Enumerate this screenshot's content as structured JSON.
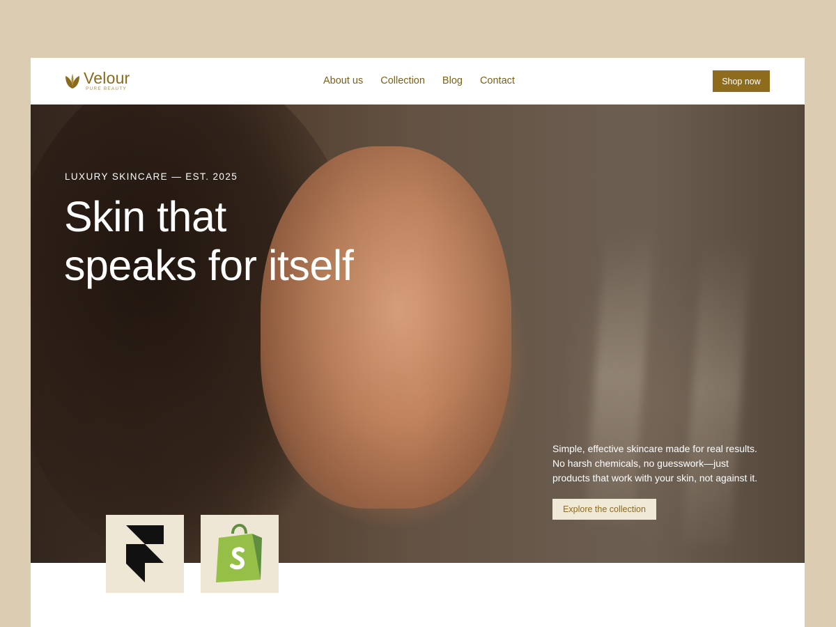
{
  "brand": {
    "name": "Velour",
    "tagline": "PURE BEAUTY",
    "logo_icon": "leaf-icon",
    "color": "#8a6a1c"
  },
  "nav": {
    "items": [
      {
        "label": "About us"
      },
      {
        "label": "Collection"
      },
      {
        "label": "Blog"
      },
      {
        "label": "Contact"
      }
    ]
  },
  "header": {
    "cta_label": "Shop now"
  },
  "hero": {
    "eyebrow": "LUXURY SKINCARE — EST. 2025",
    "headline_line1": "Skin that",
    "headline_line2": "speaks for itself",
    "copy_line1": "Simple, effective skincare made for real results.",
    "copy_line2": "No harsh chemicals, no guesswork—just",
    "copy_line3": "products that work with your skin, not against it.",
    "cta_label": "Explore the collection",
    "image": "woman-touching-face-photo"
  },
  "badges": [
    {
      "icon": "framer-logo-icon",
      "color": "#111111"
    },
    {
      "icon": "shopify-logo-icon",
      "color": "#7ab648"
    }
  ],
  "colors": {
    "page_background": "#dccdb2",
    "accent": "#8f6c1d",
    "button_light": "#f1e9d8",
    "badge_background": "#efe7d6"
  }
}
